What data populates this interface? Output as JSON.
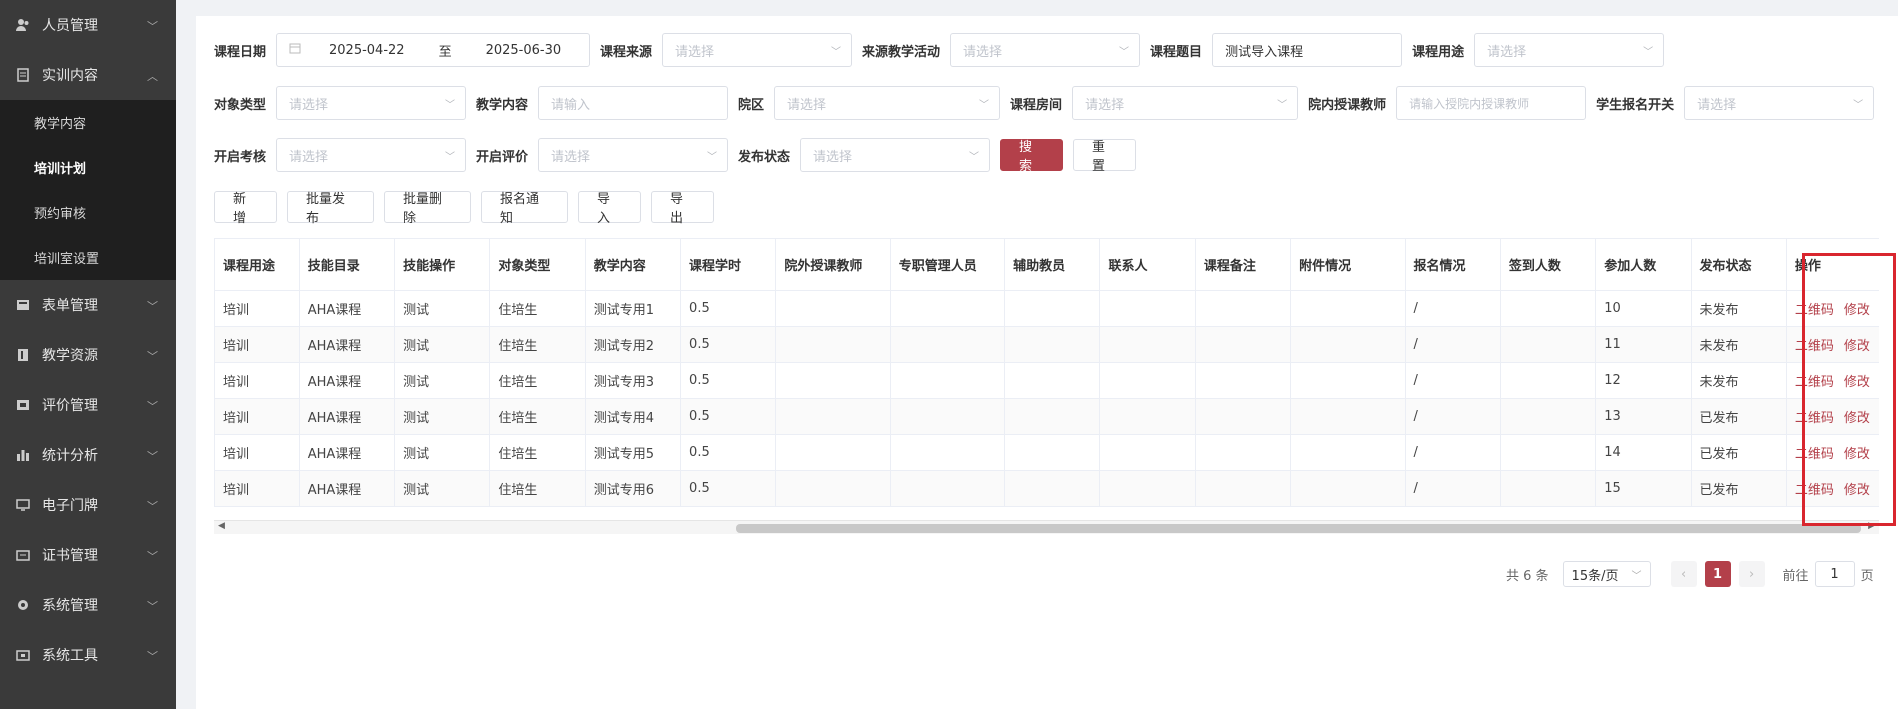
{
  "sidebar": {
    "items": [
      {
        "icon": "users-icon",
        "label": "人员管理"
      },
      {
        "icon": "doc-icon",
        "label": "实训内容"
      },
      {
        "icon": "form-icon",
        "label": "表单管理"
      },
      {
        "icon": "book-icon",
        "label": "教学资源"
      },
      {
        "icon": "rating-icon",
        "label": "评价管理"
      },
      {
        "icon": "bar-chart-icon",
        "label": "统计分析"
      },
      {
        "icon": "monitor-icon",
        "label": "电子门牌"
      },
      {
        "icon": "certificate-icon",
        "label": "证书管理"
      },
      {
        "icon": "gear-icon",
        "label": "系统管理"
      },
      {
        "icon": "toolbox-icon",
        "label": "系统工具"
      }
    ],
    "submenu": [
      "教学内容",
      "培训计划",
      "预约审核",
      "培训室设置"
    ]
  },
  "filters": {
    "course_date": {
      "label": "课程日期",
      "start": "2025-04-22",
      "sep": "至",
      "end": "2025-06-30"
    },
    "course_source": {
      "label": "课程来源",
      "placeholder": "请选择"
    },
    "source_activity": {
      "label": "来源教学活动",
      "placeholder": "请选择"
    },
    "course_title": {
      "label": "课程题目",
      "value": "测试导入课程"
    },
    "course_use": {
      "label": "课程用途",
      "placeholder": "请选择"
    },
    "object_type": {
      "label": "对象类型",
      "placeholder": "请选择"
    },
    "teach_content": {
      "label": "教学内容",
      "placeholder": "请输入"
    },
    "campus": {
      "label": "院区",
      "placeholder": "请选择"
    },
    "course_room": {
      "label": "课程房间",
      "placeholder": "请选择"
    },
    "inner_teacher": {
      "label": "院内授课教师",
      "placeholder": "请输入授院内授课教师"
    },
    "signup_switch": {
      "label": "学生报名开关",
      "placeholder": "请选择"
    },
    "open_exam": {
      "label": "开启考核",
      "placeholder": "请选择"
    },
    "open_eval": {
      "label": "开启评价",
      "placeholder": "请选择"
    },
    "publish_status": {
      "label": "发布状态",
      "placeholder": "请选择"
    },
    "search_btn": "搜索",
    "reset_btn": "重置"
  },
  "toolbar": [
    "新增",
    "批量发布",
    "批量删除",
    "报名通知",
    "导入",
    "导出"
  ],
  "table": {
    "columns": [
      "课程用途",
      "技能目录",
      "技能操作",
      "对象类型",
      "教学内容",
      "课程学时",
      "院外授课教师",
      "专职管理人员",
      "辅助教员",
      "联系人",
      "课程备注",
      "附件情况",
      "报名情况",
      "签到人数",
      "参加人数",
      "发布状态",
      "操作"
    ],
    "rows": [
      [
        "培训",
        "AHA课程",
        "测试",
        "住培生",
        "测试专用1",
        "0.5",
        "",
        "",
        "",
        "",
        "",
        "",
        "/",
        "",
        "10",
        "未发布"
      ],
      [
        "培训",
        "AHA课程",
        "测试",
        "住培生",
        "测试专用2",
        "0.5",
        "",
        "",
        "",
        "",
        "",
        "",
        "/",
        "",
        "11",
        "未发布"
      ],
      [
        "培训",
        "AHA课程",
        "测试",
        "住培生",
        "测试专用3",
        "0.5",
        "",
        "",
        "",
        "",
        "",
        "",
        "/",
        "",
        "12",
        "未发布"
      ],
      [
        "培训",
        "AHA课程",
        "测试",
        "住培生",
        "测试专用4",
        "0.5",
        "",
        "",
        "",
        "",
        "",
        "",
        "/",
        "",
        "13",
        "已发布"
      ],
      [
        "培训",
        "AHA课程",
        "测试",
        "住培生",
        "测试专用5",
        "0.5",
        "",
        "",
        "",
        "",
        "",
        "",
        "/",
        "",
        "14",
        "已发布"
      ],
      [
        "培训",
        "AHA课程",
        "测试",
        "住培生",
        "测试专用6",
        "0.5",
        "",
        "",
        "",
        "",
        "",
        "",
        "/",
        "",
        "15",
        "已发布"
      ]
    ],
    "op_qrcode": "二维码",
    "op_edit": "修改"
  },
  "pagination": {
    "total": "共 6 条",
    "page_size": "15条/页",
    "current": "1",
    "goto_prefix": "前往",
    "goto_value": "1",
    "goto_suffix": "页"
  },
  "colors": {
    "accent": "#b3404a",
    "highlight": "#d9262e"
  }
}
